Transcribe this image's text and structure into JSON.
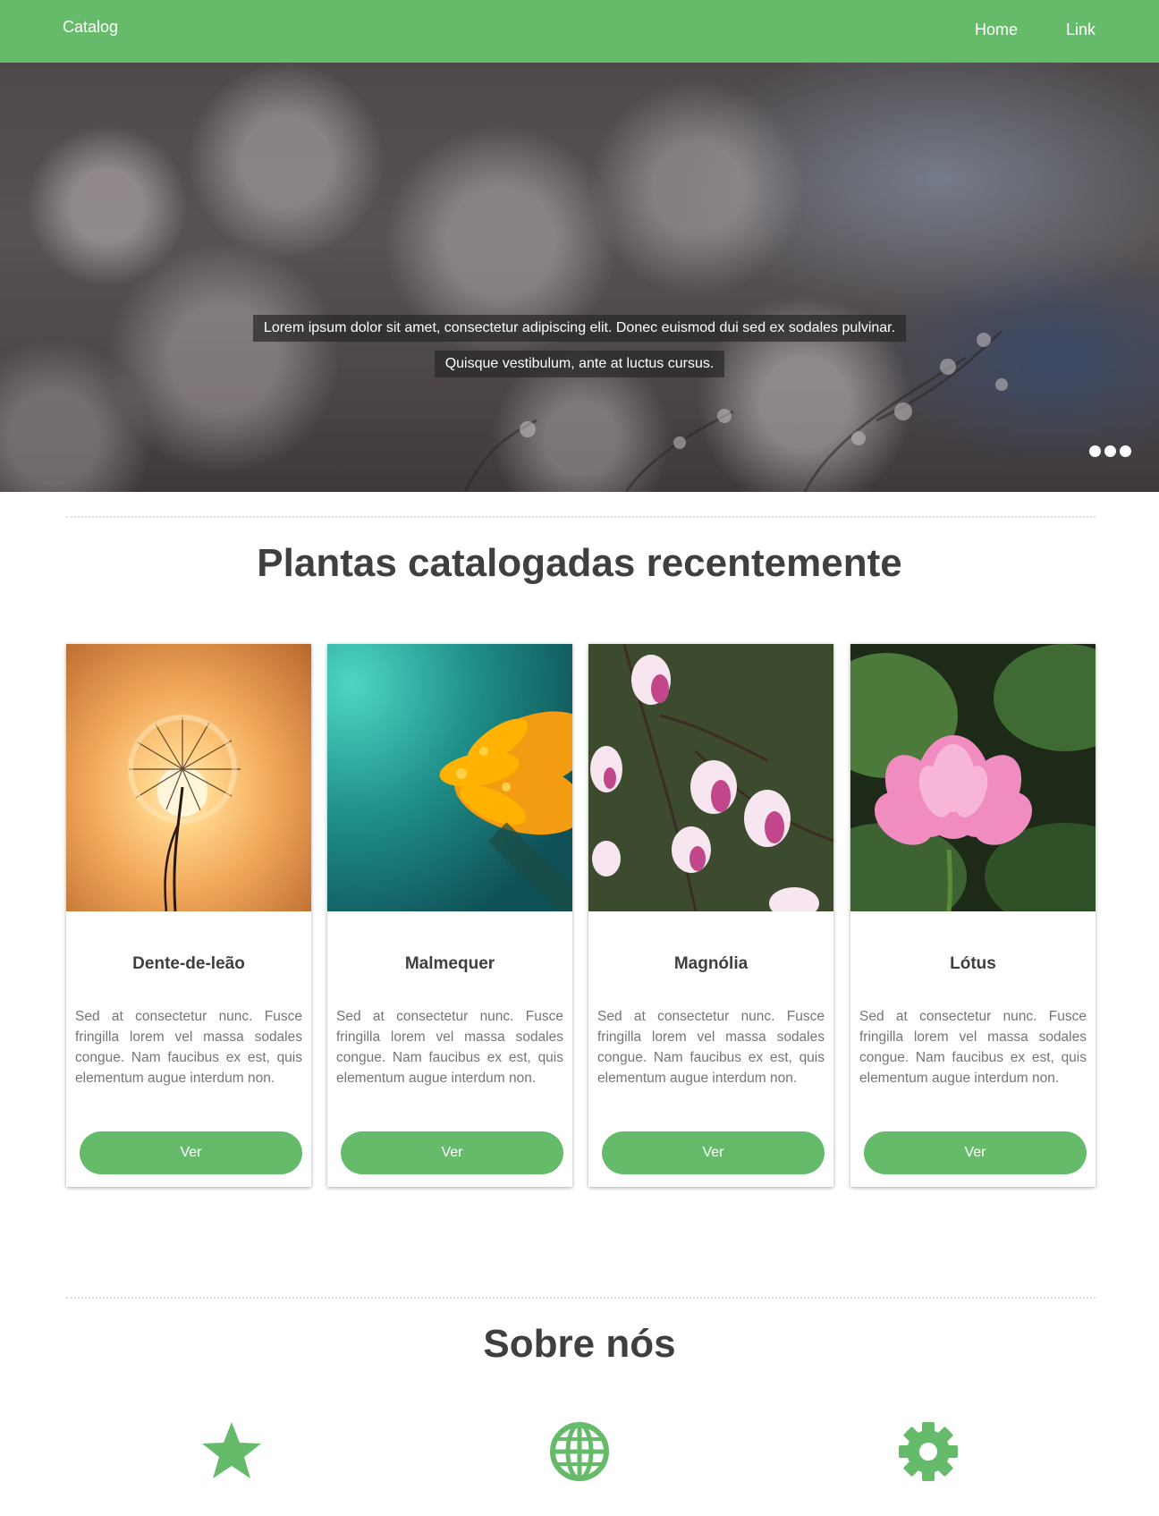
{
  "navbar": {
    "brand": "Catalog",
    "links": [
      {
        "label": "Home"
      },
      {
        "label": "Link"
      }
    ]
  },
  "hero": {
    "caption_line1": "Lorem ipsum dolor sit amet, consectetur adipiscing elit. Donec euismod dui sed ex sodales pulvinar.",
    "caption_line2": "Quisque vestibulum, ante at luctus cursus.",
    "slide_indicators": 3
  },
  "recent": {
    "title": "Plantas catalogadas recentemente",
    "cards": [
      {
        "name": "Dente-de-leão",
        "text": "Sed at consectetur nunc. Fusce fringilla lorem vel massa sodales congue. Nam faucibus ex est, quis elementum augue interdum non.",
        "button": "Ver",
        "image": "dandelion-sunset"
      },
      {
        "name": "Malmequer",
        "text": "Sed at consectetur nunc. Fusce fringilla lorem vel massa sodales congue. Nam faucibus ex est, quis elementum augue interdum non.",
        "button": "Ver",
        "image": "orange-marigold"
      },
      {
        "name": "Magnólia",
        "text": "Sed at consectetur nunc. Fusce fringilla lorem vel massa sodales congue. Nam faucibus ex est, quis elementum augue interdum non.",
        "button": "Ver",
        "image": "pink-magnolia"
      },
      {
        "name": "Lótus",
        "text": "Sed at consectetur nunc. Fusce fringilla lorem vel massa sodales congue. Nam faucibus ex est, quis elementum augue interdum non.",
        "button": "Ver",
        "image": "pink-lotus"
      }
    ]
  },
  "about": {
    "title": "Sobre nós",
    "icons": [
      "star-icon",
      "globe-icon",
      "gear-icon"
    ]
  },
  "colors": {
    "accent": "#66bb6a",
    "heading": "#3f3f3f",
    "body_text": "#757575"
  }
}
